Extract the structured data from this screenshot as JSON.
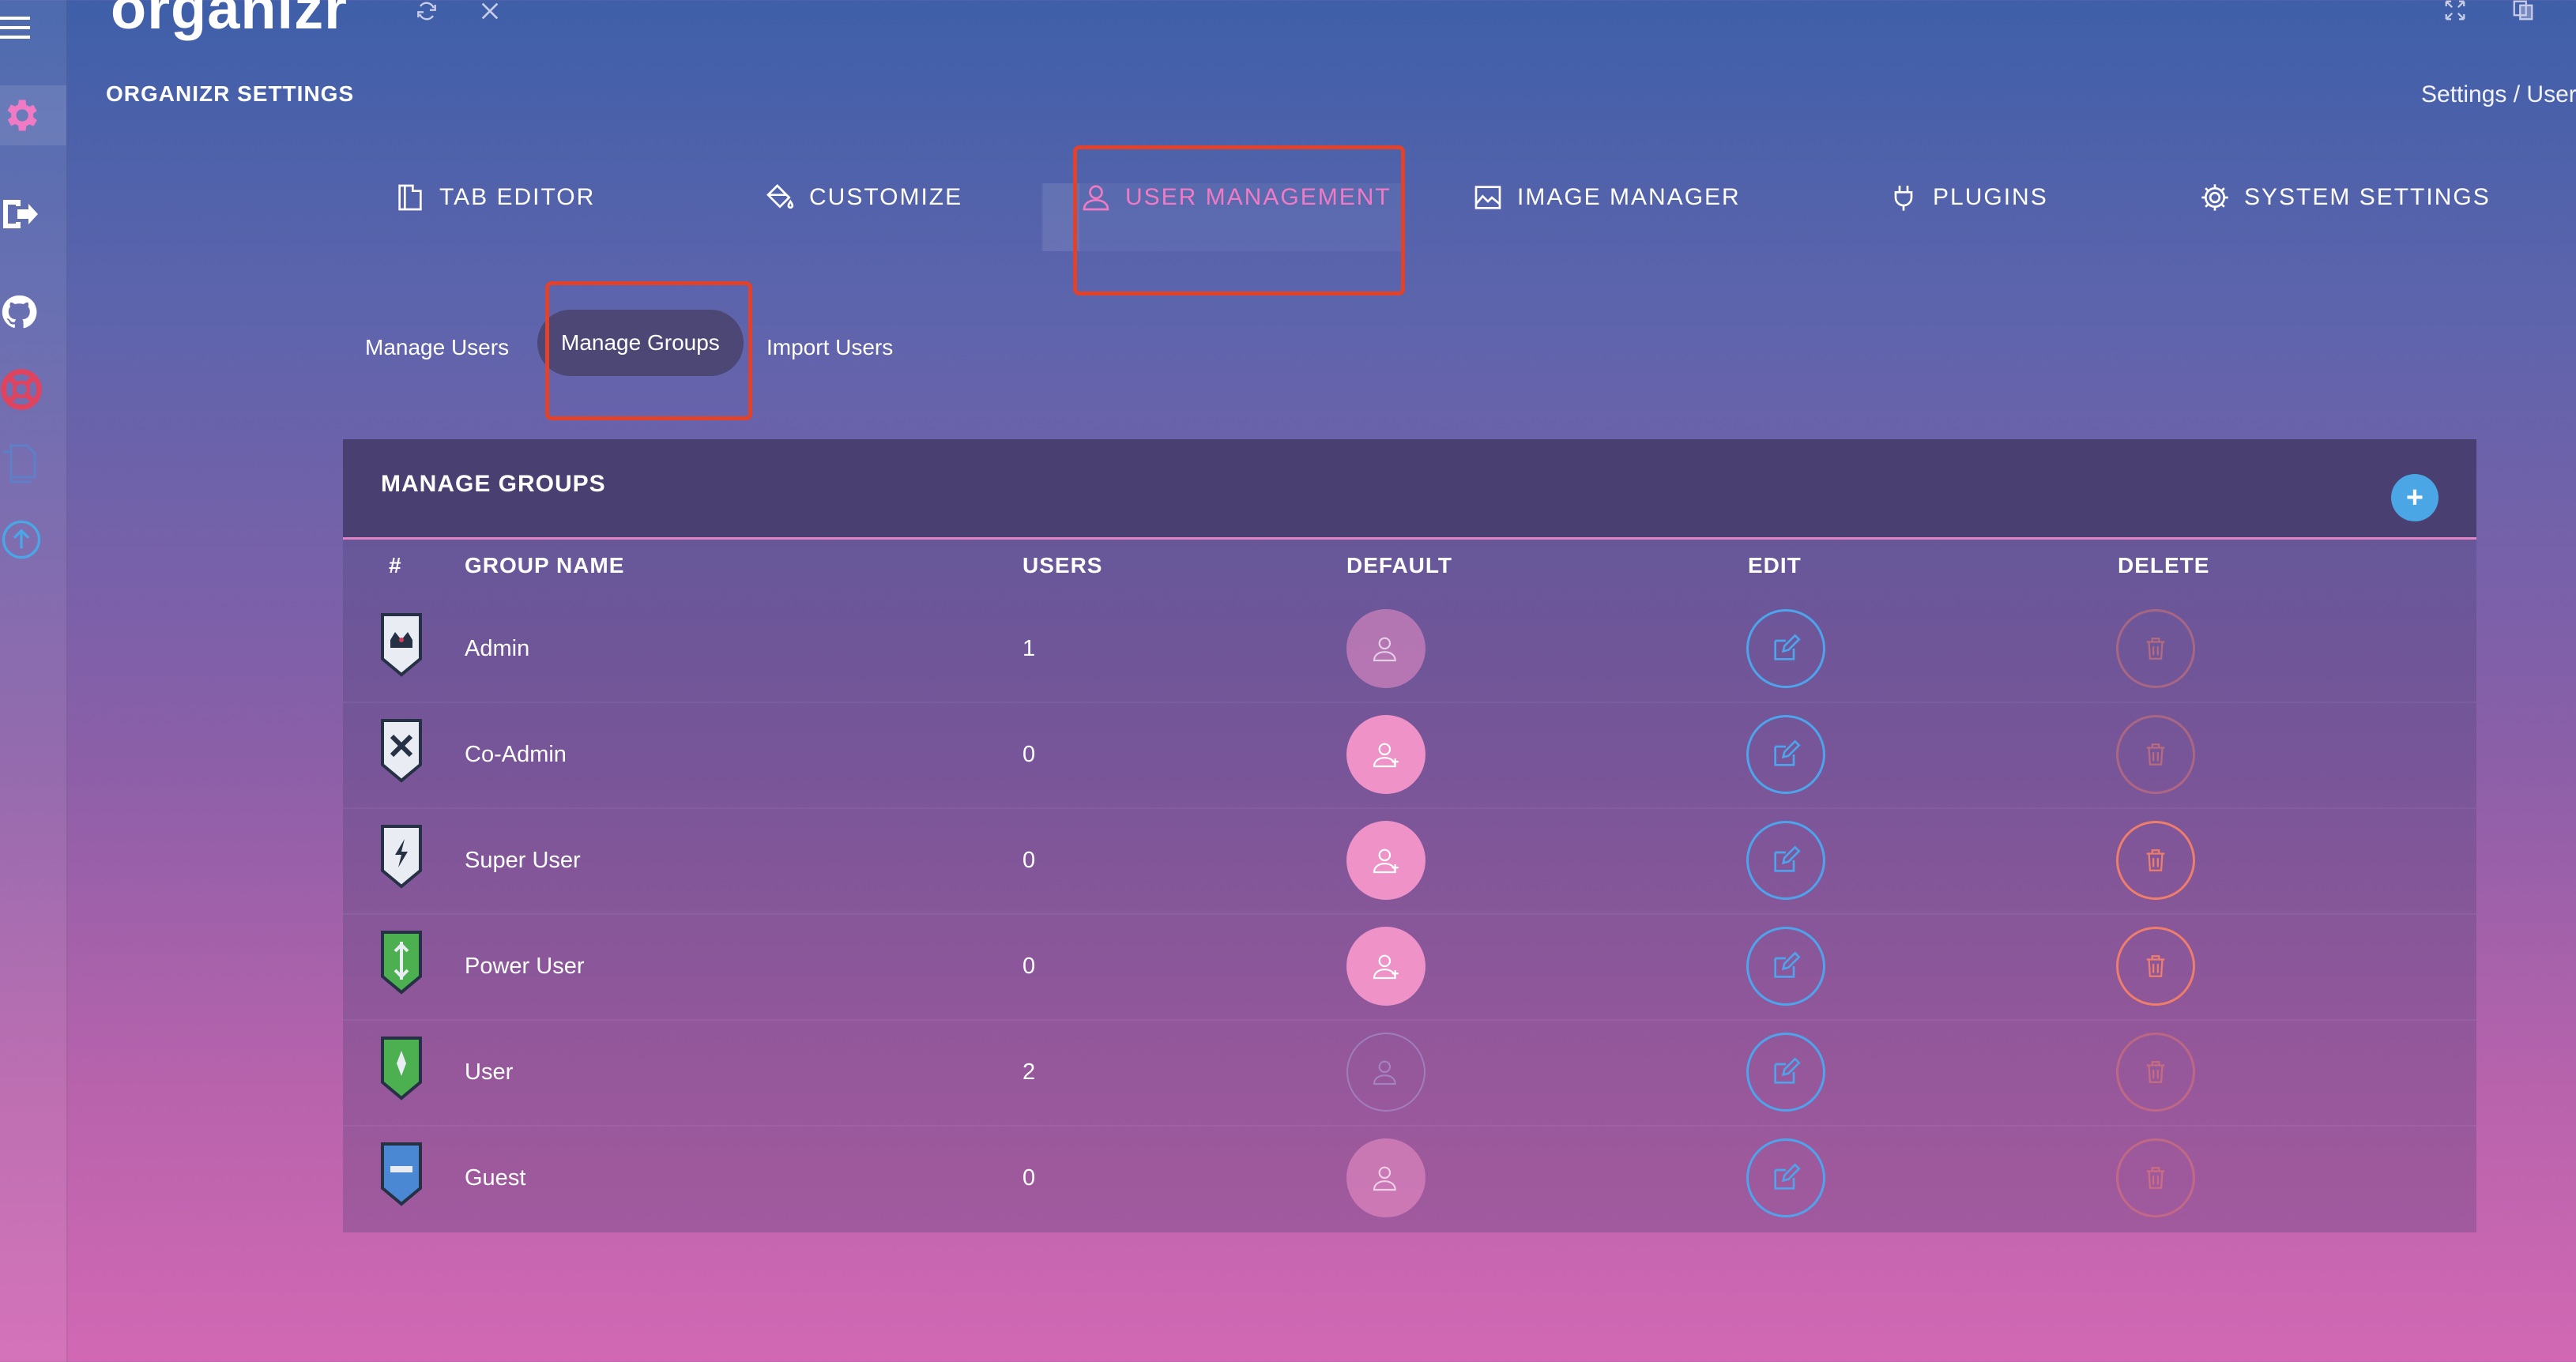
{
  "app": {
    "logo_text": "organizr",
    "section_title": "ORGANIZR SETTINGS",
    "breadcrumb": "Settings / User"
  },
  "main_tabs": [
    {
      "label": "TAB EDITOR",
      "icon": "tab-editor-icon"
    },
    {
      "label": "CUSTOMIZE",
      "icon": "paint-bucket-icon"
    },
    {
      "label": "USER MANAGEMENT",
      "icon": "user-icon",
      "active": true
    },
    {
      "label": "IMAGE MANAGER",
      "icon": "image-icon"
    },
    {
      "label": "PLUGINS",
      "icon": "plug-icon"
    },
    {
      "label": "SYSTEM SETTINGS",
      "icon": "gear-icon"
    }
  ],
  "sub_tabs": [
    {
      "label": "Manage Users"
    },
    {
      "label": "Manage Groups",
      "active": true
    },
    {
      "label": "Import Users"
    }
  ],
  "panel": {
    "title": "MANAGE GROUPS",
    "add_label": "+",
    "columns": [
      "#",
      "GROUP NAME",
      "USERS",
      "DEFAULT",
      "EDIT",
      "DELETE"
    ]
  },
  "groups": [
    {
      "name": "Admin",
      "users": "1",
      "icon": "admin-shield-icon",
      "default_state": "faded",
      "delete_enabled": false
    },
    {
      "name": "Co-Admin",
      "users": "0",
      "icon": "co-admin-shield-icon",
      "default_state": "on",
      "delete_enabled": false
    },
    {
      "name": "Super User",
      "users": "0",
      "icon": "super-user-shield-icon",
      "default_state": "on",
      "delete_enabled": true
    },
    {
      "name": "Power User",
      "users": "0",
      "icon": "power-user-shield-icon",
      "default_state": "on",
      "delete_enabled": true
    },
    {
      "name": "User",
      "users": "2",
      "icon": "user-shield-icon",
      "default_state": "outline",
      "delete_enabled": false
    },
    {
      "name": "Guest",
      "users": "0",
      "icon": "guest-shield-icon",
      "default_state": "faded",
      "delete_enabled": false
    }
  ],
  "colors": {
    "accent_pink": "#f07bc4",
    "edit_blue": "#4ea4ec",
    "delete_red": "#ee7d6a",
    "highlight_red": "#e2412a",
    "header_bg": "#493f70"
  }
}
